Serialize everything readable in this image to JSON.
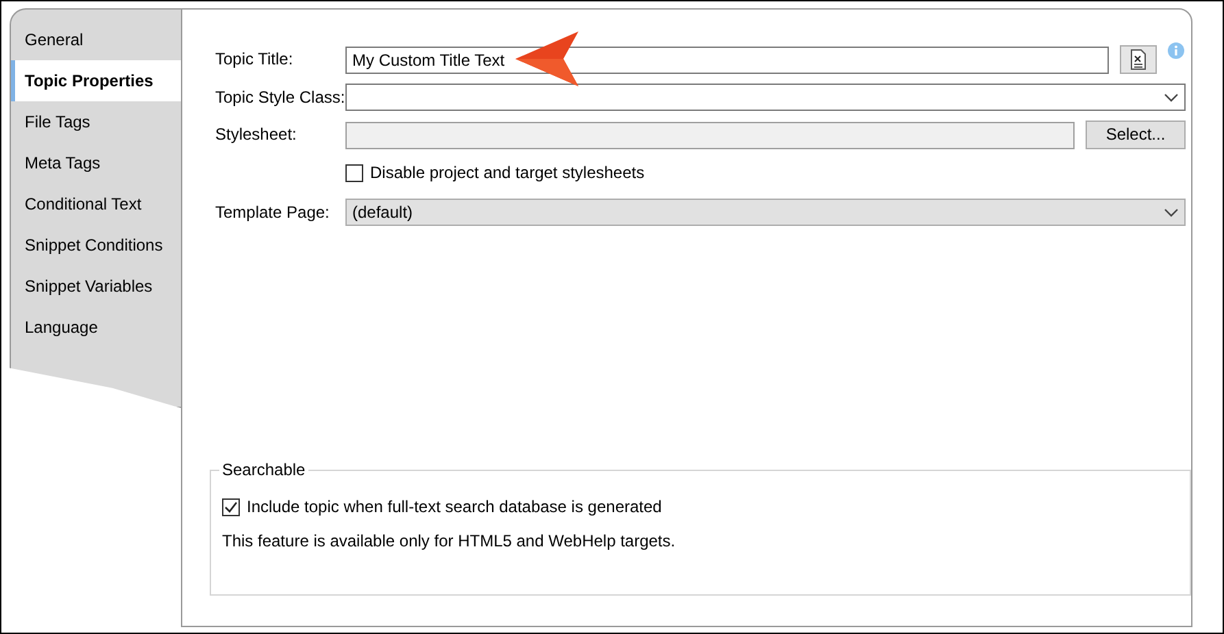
{
  "tabs": [
    {
      "label": "General",
      "selected": false
    },
    {
      "label": "Topic Properties",
      "selected": true
    },
    {
      "label": "File Tags",
      "selected": false
    },
    {
      "label": "Meta Tags",
      "selected": false
    },
    {
      "label": "Conditional Text",
      "selected": false
    },
    {
      "label": "Snippet Conditions",
      "selected": false
    },
    {
      "label": "Snippet Variables",
      "selected": false
    },
    {
      "label": "Language",
      "selected": false
    }
  ],
  "topic_title": {
    "label": "Topic Title:",
    "value": "My Custom Title Text"
  },
  "topic_style_class": {
    "label": "Topic Style Class:"
  },
  "stylesheet": {
    "label": "Stylesheet:",
    "disabled": true,
    "button": "Select..."
  },
  "disable_stylesheets": {
    "label": "Disable project and target stylesheets",
    "checked": false
  },
  "template_page": {
    "label": "Template Page:",
    "value": "(default)",
    "disabled": true
  },
  "searchable": {
    "legend": "Searchable",
    "include": {
      "label": "Include topic when full-text search database is generated",
      "checked": true
    },
    "note": "This feature is available only for HTML5 and WebHelp targets."
  }
}
